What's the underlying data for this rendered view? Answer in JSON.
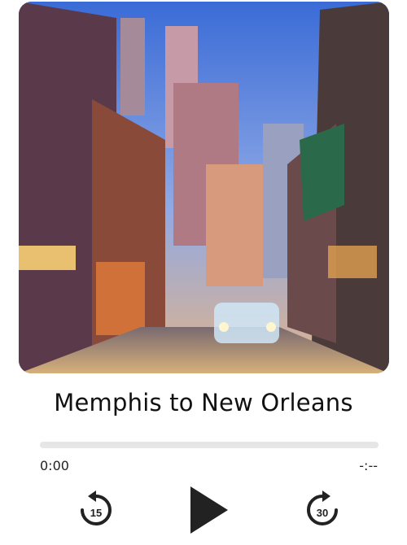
{
  "episode": {
    "title": "Memphis to New Orleans"
  },
  "artwork": {
    "icon": "album-artwork-image",
    "description_hidden": true
  },
  "progress": {
    "fraction": 0,
    "elapsed": "0:00",
    "remaining": "-:--"
  },
  "controls": {
    "skip_back_seconds": "15",
    "skip_forward_seconds": "30",
    "play_icon": "play-icon",
    "skip_back_icon": "rewind-15-icon",
    "skip_forward_icon": "forward-30-icon"
  },
  "colors": {
    "text": "#111111",
    "control": "#222222",
    "track": "#e6e6e6"
  }
}
